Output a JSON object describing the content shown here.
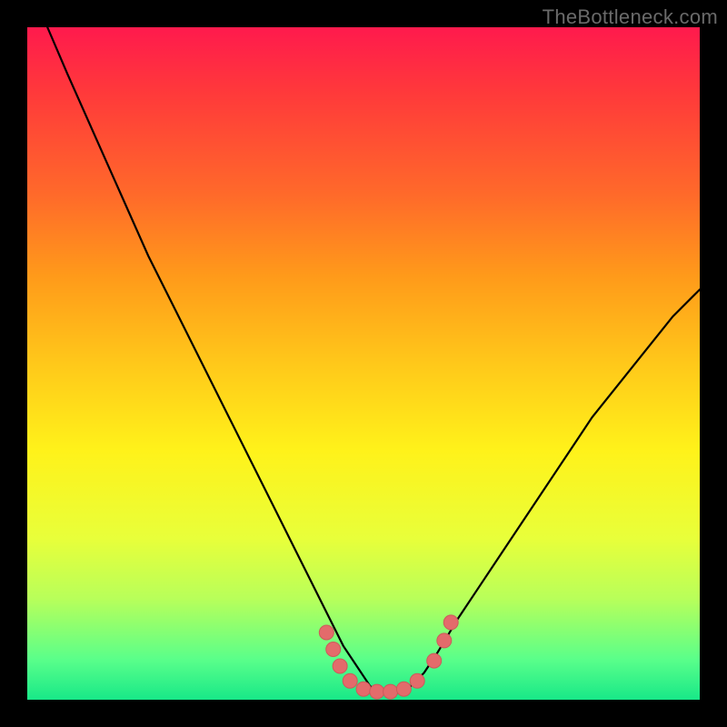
{
  "watermark": "TheBottleneck.com",
  "colors": {
    "frame": "#000000",
    "marker": "#e36b6b",
    "curve": "#000000",
    "gradient_stops": [
      "#ff1a4d",
      "#ff3a3a",
      "#ff6a2a",
      "#ff9a1a",
      "#ffc81a",
      "#fff21a",
      "#e8ff3a",
      "#b8ff5a",
      "#5aff8a",
      "#18e888"
    ]
  },
  "chart_data": {
    "type": "line",
    "title": "",
    "xlabel": "",
    "ylabel": "",
    "xlim": [
      0,
      100
    ],
    "ylim": [
      0,
      100
    ],
    "grid": false,
    "legend": false,
    "series": [
      {
        "name": "bottleneck-curve",
        "x": [
          3,
          6,
          10,
          14,
          18,
          22,
          26,
          30,
          34,
          37,
          40,
          43,
          45,
          47,
          49,
          51,
          53,
          55,
          57,
          59,
          61,
          64,
          68,
          72,
          76,
          80,
          84,
          88,
          92,
          96,
          100
        ],
        "y": [
          100,
          93,
          84,
          75,
          66,
          58,
          50,
          42,
          34,
          28,
          22,
          16,
          12,
          8,
          5,
          2,
          1,
          1,
          2,
          4,
          7,
          12,
          18,
          24,
          30,
          36,
          42,
          47,
          52,
          57,
          61
        ]
      }
    ],
    "flat_region_markers": {
      "name": "optimal-zone-markers",
      "points": [
        {
          "x": 44.5,
          "y": 10
        },
        {
          "x": 45.5,
          "y": 7.5
        },
        {
          "x": 46.5,
          "y": 5
        },
        {
          "x": 48,
          "y": 2.8
        },
        {
          "x": 50,
          "y": 1.6
        },
        {
          "x": 52,
          "y": 1.2
        },
        {
          "x": 54,
          "y": 1.2
        },
        {
          "x": 56,
          "y": 1.6
        },
        {
          "x": 58,
          "y": 2.8
        },
        {
          "x": 60.5,
          "y": 5.8
        },
        {
          "x": 62,
          "y": 8.8
        },
        {
          "x": 63,
          "y": 11.5
        }
      ]
    }
  }
}
